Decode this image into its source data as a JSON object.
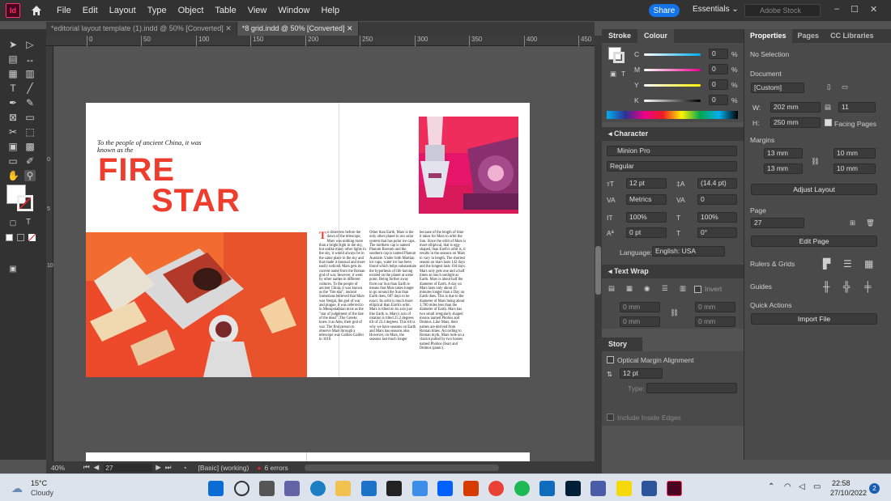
{
  "app": {
    "logo": "Id"
  },
  "menubar": {
    "items": [
      "File",
      "Edit",
      "Layout",
      "Type",
      "Object",
      "Table",
      "View",
      "Window",
      "Help"
    ],
    "share": "Share",
    "workspace": "Essentials",
    "stock_placeholder": "Adobe Stock"
  },
  "tabs": [
    {
      "label": "*editorial layout template (1).indd @ 50% [Converted]"
    },
    {
      "label": "*8 grid.indd @ 50% [Converted]"
    }
  ],
  "ruler": {
    "h": [
      "0",
      "50",
      "100",
      "150",
      "200",
      "250",
      "300",
      "350",
      "400",
      "450"
    ],
    "v": [
      "0",
      "5",
      "10"
    ]
  },
  "doc": {
    "intro": "To the people of ancient China, it was known as the",
    "title1": "FIRE",
    "title2": "STAR",
    "dropcap": "T",
    "col1": "o observers before the dawn of the telescope, Mars was nothing more than a bright light in the sky, but unlike many other lights in the sky, it would always be in the same place in the sky and that made it unusual and more easily noticed. Mars gets its current name from the Roman god of war, however, it went by other names in different cultures. To the people of ancient China, it was known as the \"fire star\", ancient Sumerians believed that Mars was Nergal, the god of war and plague, it was referred to in Mesopotamian texts as the \"star of judgement of the fate of the dead\". The Greeks knew it as Ares, their god of war. The first person to observe Mars through a telescope was Galileo Galilei in 1610.",
    "col2": "Other than Earth, Mars is the only other planet in our solar system that has polar ice caps. The northern cap is named Planum Boreum and the southern cap is named Planum Australe. Under both Martian ice caps, water ice has been found which helps substantiate the hypothesis of life having existed on the planet at some point. Being further away from our Sun than Earth is means that Mars takes longer to go around the Sun than Earth does, 687 days to be exact. Its orbit is much more elliptical than Earth's orbit. Mars is tilted on its axis just like Earth is. Mars's axis of rotation is tilted 25.2 degrees tilt of 23.4 degrees. This tilt is why we have seasons on Earth and Mars has seasons also. However, on Mars, the seasons last much longer",
    "col3": "because of the length of time it takes for Mars to orbit the Sun. Since the orbit of Mars is more elliptical, that is egg-shaped, than Earth's orbit is, it results in the seasons on Mars to vary in length. The shortest season on mars lasts 142 days and the longest lasts 194 days. Mars only gets one and a half times as much sunlight as Earth. Mars is about half the diameter of Earth. A day on Mars lasts only about 41 minutes longer than a Day on Earth does. This is due to the diameter of Mars being about 3,700 miles less than the diameter of Earth. Mars has two small irregularly shaped moons named Phobos and Deimos. Like Mars, their names are derived from Roman times. According to Roman myth, Mars rode on a chariot pulled by two horses named Phobos (fear) and Deimos (panic)."
  },
  "status": {
    "zoom": "40%",
    "page": "27",
    "style": "[Basic] (working)",
    "errors": "6 errors"
  },
  "colour": {
    "tabs": [
      "Stroke",
      "Colour"
    ],
    "channels": [
      {
        "k": "C",
        "v": "0"
      },
      {
        "k": "M",
        "v": "0"
      },
      {
        "k": "Y",
        "v": "0"
      },
      {
        "k": "K",
        "v": "0"
      }
    ],
    "pct": "%"
  },
  "character": {
    "title": "Character",
    "font": "Minion Pro",
    "style": "Regular",
    "size": "12 pt",
    "leading": "(14.4 pt)",
    "kern": "Metrics",
    "track": "0",
    "vscale": "100%",
    "hscale": "100%",
    "baseline": "0 pt",
    "skew": "0°",
    "lang_label": "Language:",
    "lang": "English: USA"
  },
  "textwrap": {
    "title": "Text Wrap",
    "invert": "Invert",
    "offsets": [
      "0 mm",
      "0 mm",
      "0 mm",
      "0 mm"
    ]
  },
  "story": {
    "title": "Story",
    "oma": "Optical Margin Alignment",
    "size": "12 pt",
    "type_label": "Type:",
    "include": "Include Inside Edges"
  },
  "props": {
    "tabs": [
      "Properties",
      "Pages",
      "CC Libraries"
    ],
    "selection": "No Selection",
    "document": "Document",
    "preset": "[Custom]",
    "w_label": "W:",
    "w": "202 mm",
    "h_label": "H:",
    "h": "250 mm",
    "pages": "11",
    "facing": "Facing Pages",
    "margins": "Margins",
    "m1": "13 mm",
    "m2": "13 mm",
    "m3": "10 mm",
    "m4": "10 mm",
    "adjust": "Adjust Layout",
    "page": "Page",
    "page_num": "27",
    "edit_page": "Edit Page",
    "rulers": "Rulers & Grids",
    "guides": "Guides",
    "quick": "Quick Actions",
    "import": "Import File"
  },
  "taskbar": {
    "temp": "15°C",
    "weather": "Cloudy",
    "time": "22:58",
    "date": "27/10/2022",
    "badge": "2"
  }
}
